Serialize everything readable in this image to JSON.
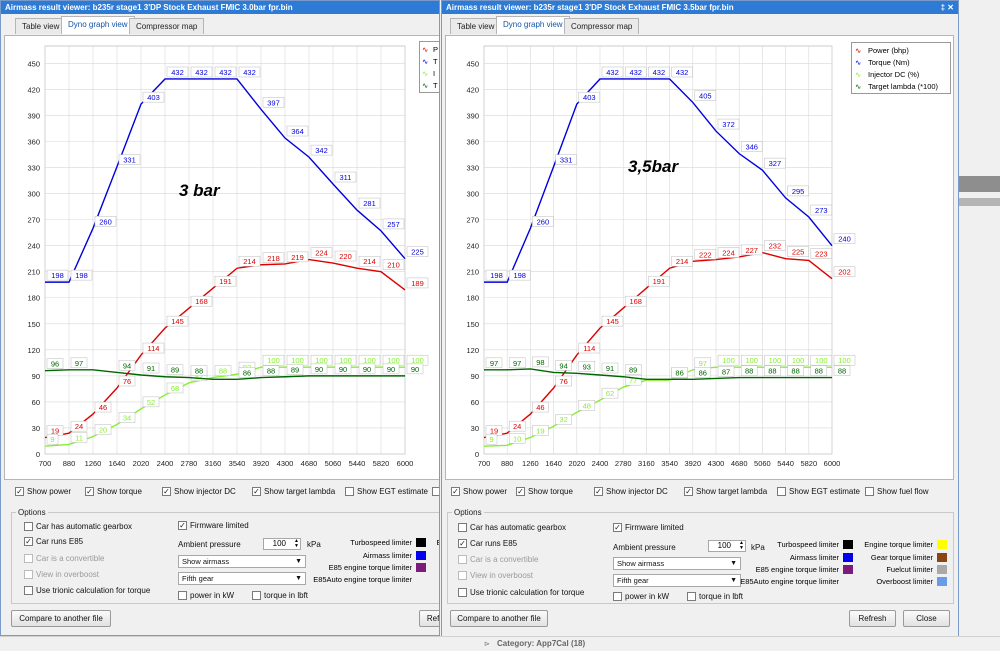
{
  "window1": {
    "title": "Airmass result viewer: b235r stage1 3'DP Stock Exhaust FMIC 3.0bar fpr.bin",
    "tabs": [
      "Table view",
      "Dyno graph view",
      "Compressor map"
    ],
    "annotation": "3 bar",
    "legend": [
      "P",
      "T",
      "I",
      "T"
    ],
    "checkboxes": [
      {
        "label": "Show power",
        "checked": true
      },
      {
        "label": "Show torque",
        "checked": true
      },
      {
        "label": "Show injector DC",
        "checked": true
      },
      {
        "label": "Show target lambda",
        "checked": true
      },
      {
        "label": "Show EGT estimate",
        "checked": false
      },
      {
        "label": "",
        "checked": false
      }
    ],
    "options": {
      "group_label": "Options",
      "automatic": "Car has automatic gearbox",
      "e85": "Car runs E85",
      "convertible": "Car is a convertible",
      "overboost": "View in overboost",
      "trionic": "Use trionic calculation for torque",
      "firmware": "Firmware limited",
      "ambient_label": "Ambient pressure",
      "ambient_value": "100",
      "ambient_unit": "kPa",
      "airmass_select": "Show airmass",
      "gear_select": "Fifth gear",
      "power_kw": "power in kW",
      "torque_lbft": "torque in lbft",
      "limiters": [
        {
          "label": "Turbospeed limiter",
          "color": "#000000"
        },
        {
          "label": "Airmass limiter",
          "color": "#0000ee"
        },
        {
          "label": "E85 engine torque limiter",
          "color": "#7b1b7b"
        },
        {
          "label": "E85Auto engine torque limiter",
          "color": ""
        }
      ],
      "extra_limiter": "Er"
    },
    "compare_button": "Compare to another file",
    "refresh_button": "Refi"
  },
  "window2": {
    "title": "Airmass result viewer: b235r stage1 3'DP Stock Exhaust FMIC 3.5bar fpr.bin",
    "controls": "‡ ✕",
    "tabs": [
      "Table view",
      "Dyno graph view",
      "Compressor map"
    ],
    "annotation": "3,5bar",
    "legend": [
      "Power (bhp)",
      "Torque (Nm)",
      "Injector DC (%)",
      "Target lambda (*100)"
    ],
    "checkboxes": [
      {
        "label": "Show power",
        "checked": true
      },
      {
        "label": "Show torque",
        "checked": true
      },
      {
        "label": "Show injector DC",
        "checked": true
      },
      {
        "label": "Show target lambda",
        "checked": true
      },
      {
        "label": "Show EGT estimate",
        "checked": false
      },
      {
        "label": "Show fuel flow",
        "checked": false
      }
    ],
    "options": {
      "group_label": "Options",
      "automatic": "Car has automatic gearbox",
      "e85": "Car runs E85",
      "convertible": "Car is a convertible",
      "overboost": "View in overboost",
      "trionic": "Use trionic calculation for torque",
      "firmware": "Firmware limited",
      "ambient_label": "Ambient pressure",
      "ambient_value": "100",
      "ambient_unit": "kPa",
      "airmass_select": "Show airmass",
      "gear_select": "Fifth gear",
      "power_kw": "power in kW",
      "torque_lbft": "torque in lbft",
      "limiters": [
        {
          "label": "Turbospeed limiter",
          "color": "#000000"
        },
        {
          "label": "Airmass limiter",
          "color": "#0000ee"
        },
        {
          "label": "E85 engine torque limiter",
          "color": "#7b1b7b"
        },
        {
          "label": "E85Auto engine torque limiter",
          "color": ""
        }
      ],
      "limiters_right": [
        {
          "label": "Engine torque limiter",
          "color": "#ffff00"
        },
        {
          "label": "Gear torque limiter",
          "color": "#8b4513"
        },
        {
          "label": "Fuelcut limiter",
          "color": "#a9a9a9"
        },
        {
          "label": "Overboost limiter",
          "color": "#6a9be8"
        }
      ]
    },
    "compare_button": "Compare to another file",
    "refresh_button": "Refresh",
    "close_button": "Close"
  },
  "taskbar": {
    "category": "Category: App7Cal (18)"
  },
  "chart_data": [
    {
      "type": "line",
      "title": "",
      "x": [
        700,
        880,
        1260,
        1640,
        2020,
        2400,
        2780,
        3160,
        3540,
        3920,
        4300,
        4680,
        5060,
        5440,
        5820,
        6000
      ],
      "ylim": [
        0,
        470
      ],
      "yticks": [
        0,
        30,
        60,
        90,
        120,
        150,
        180,
        210,
        240,
        270,
        300,
        330,
        360,
        390,
        420,
        450
      ],
      "series": [
        {
          "name": "P",
          "color": "#dd0000",
          "points": [
            [
              700,
              19
            ],
            [
              880,
              24
            ],
            [
              1260,
              46
            ],
            [
              1640,
              76
            ],
            [
              2020,
              114
            ],
            [
              2400,
              145
            ],
            [
              2780,
              168
            ],
            [
              3160,
              191
            ],
            [
              3540,
              214
            ],
            [
              3920,
              218
            ],
            [
              4300,
              219
            ],
            [
              4680,
              224
            ],
            [
              5060,
              220
            ],
            [
              5440,
              214
            ],
            [
              5820,
              210
            ],
            [
              6000,
              189
            ]
          ],
          "labels": [
            19,
            24,
            46,
            76,
            114,
            145,
            168,
            191,
            214,
            218,
            219,
            224,
            220,
            214,
            210,
            189
          ]
        },
        {
          "name": "T",
          "color": "#0000dd",
          "points": [
            [
              700,
              198
            ],
            [
              880,
              198
            ],
            [
              1260,
              260
            ],
            [
              1640,
              331
            ],
            [
              2020,
              403
            ],
            [
              2400,
              432
            ],
            [
              2780,
              432
            ],
            [
              3160,
              432
            ],
            [
              3540,
              432
            ],
            [
              3920,
              397
            ],
            [
              4300,
              364
            ],
            [
              4680,
              342
            ],
            [
              5060,
              311
            ],
            [
              5440,
              281
            ],
            [
              5820,
              257
            ],
            [
              6000,
              225
            ]
          ],
          "labels": [
            198,
            198,
            260,
            331,
            403,
            432,
            432,
            432,
            432,
            397,
            364,
            342,
            311,
            281,
            257,
            225
          ]
        },
        {
          "name": "I",
          "color": "#88ee33",
          "points": [
            [
              700,
              9
            ],
            [
              880,
              11
            ],
            [
              1260,
              20
            ],
            [
              1640,
              34
            ],
            [
              2020,
              52
            ],
            [
              2400,
              68
            ],
            [
              2780,
              82
            ],
            [
              3160,
              88
            ],
            [
              3540,
              92
            ],
            [
              3920,
              100
            ],
            [
              4300,
              100
            ],
            [
              4680,
              100
            ],
            [
              5060,
              100
            ],
            [
              5440,
              100
            ],
            [
              5820,
              100
            ],
            [
              6000,
              100
            ]
          ],
          "labels": [
            9,
            11,
            20,
            34,
            52,
            68,
            82,
            88,
            92,
            100,
            100,
            100,
            100,
            100,
            100,
            100
          ]
        },
        {
          "name": "T",
          "color": "#006600",
          "points": [
            [
              700,
              96
            ],
            [
              880,
              97
            ],
            [
              1260,
              97
            ],
            [
              1640,
              94
            ],
            [
              2020,
              91
            ],
            [
              2400,
              89
            ],
            [
              2780,
              88
            ],
            [
              3160,
              86
            ],
            [
              3540,
              86
            ],
            [
              3920,
              88
            ],
            [
              4300,
              89
            ],
            [
              4680,
              90
            ],
            [
              5060,
              90
            ],
            [
              5440,
              90
            ],
            [
              5820,
              90
            ],
            [
              6000,
              90
            ]
          ],
          "labels": [
            96,
            97,
            null,
            94,
            91,
            89,
            88,
            null,
            86,
            88,
            89,
            90,
            90,
            90,
            90,
            90
          ]
        }
      ]
    },
    {
      "type": "line",
      "title": "",
      "x": [
        700,
        880,
        1260,
        1640,
        2020,
        2400,
        2780,
        3160,
        3540,
        3920,
        4300,
        4680,
        5060,
        5440,
        5820,
        6000
      ],
      "ylim": [
        0,
        470
      ],
      "yticks": [
        0,
        30,
        60,
        90,
        120,
        150,
        180,
        210,
        240,
        270,
        300,
        330,
        360,
        390,
        420,
        450
      ],
      "series": [
        {
          "name": "Power (bhp)",
          "color": "#dd0000",
          "points": [
            [
              700,
              19
            ],
            [
              880,
              24
            ],
            [
              1260,
              46
            ],
            [
              1640,
              76
            ],
            [
              2020,
              114
            ],
            [
              2400,
              145
            ],
            [
              2780,
              168
            ],
            [
              3160,
              191
            ],
            [
              3540,
              214
            ],
            [
              3920,
              222
            ],
            [
              4300,
              224
            ],
            [
              4680,
              227
            ],
            [
              5060,
              232
            ],
            [
              5440,
              225
            ],
            [
              5820,
              223
            ],
            [
              6000,
              202
            ]
          ],
          "labels": [
            19,
            24,
            46,
            76,
            114,
            145,
            168,
            191,
            214,
            222,
            224,
            227,
            232,
            225,
            223,
            202
          ]
        },
        {
          "name": "Torque (Nm)",
          "color": "#0000dd",
          "points": [
            [
              700,
              198
            ],
            [
              880,
              198
            ],
            [
              1260,
              260
            ],
            [
              1640,
              331
            ],
            [
              2020,
              403
            ],
            [
              2400,
              432
            ],
            [
              2780,
              432
            ],
            [
              3160,
              432
            ],
            [
              3540,
              432
            ],
            [
              3920,
              405
            ],
            [
              4300,
              372
            ],
            [
              4680,
              346
            ],
            [
              5060,
              327
            ],
            [
              5440,
              295
            ],
            [
              5820,
              273
            ],
            [
              6000,
              240
            ]
          ],
          "labels": [
            198,
            198,
            260,
            331,
            403,
            432,
            432,
            432,
            432,
            405,
            372,
            346,
            327,
            295,
            273,
            240
          ]
        },
        {
          "name": "Injector DC (%)",
          "color": "#88ee33",
          "points": [
            [
              700,
              9
            ],
            [
              880,
              10
            ],
            [
              1260,
              19
            ],
            [
              1640,
              32
            ],
            [
              2020,
              48
            ],
            [
              2400,
              62
            ],
            [
              2780,
              77
            ],
            [
              3160,
              85
            ],
            [
              3540,
              85
            ],
            [
              3920,
              97
            ],
            [
              4300,
              100
            ],
            [
              4680,
              100
            ],
            [
              5060,
              100
            ],
            [
              5440,
              100
            ],
            [
              5820,
              100
            ],
            [
              6000,
              100
            ]
          ],
          "labels": [
            9,
            10,
            19,
            32,
            48,
            62,
            77,
            null,
            85,
            97,
            100,
            100,
            100,
            100,
            100,
            100
          ]
        },
        {
          "name": "Target lambda (*100)",
          "color": "#006600",
          "points": [
            [
              700,
              97
            ],
            [
              880,
              97
            ],
            [
              1260,
              98
            ],
            [
              1640,
              94
            ],
            [
              2020,
              93
            ],
            [
              2400,
              91
            ],
            [
              2780,
              89
            ],
            [
              3160,
              86
            ],
            [
              3540,
              86
            ],
            [
              3920,
              86
            ],
            [
              4300,
              87
            ],
            [
              4680,
              88
            ],
            [
              5060,
              88
            ],
            [
              5440,
              88
            ],
            [
              5820,
              88
            ],
            [
              6000,
              88
            ]
          ],
          "labels": [
            97,
            97,
            98,
            94,
            93,
            91,
            89,
            null,
            86,
            86,
            87,
            88,
            88,
            88,
            88,
            88
          ]
        }
      ]
    }
  ]
}
